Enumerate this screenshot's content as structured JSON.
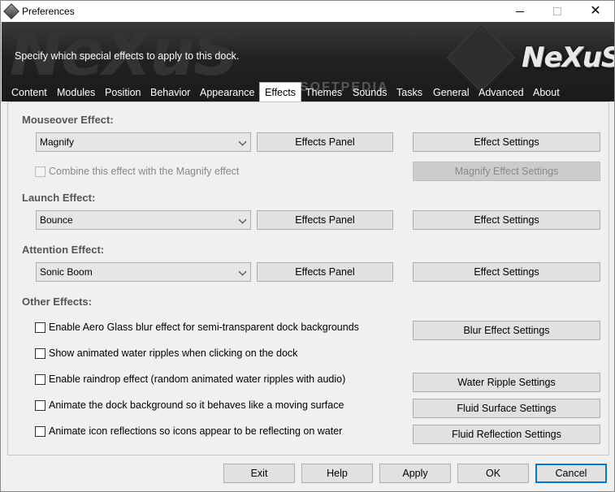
{
  "window": {
    "title": "Preferences"
  },
  "banner": {
    "description": "Specify which special effects to apply to this dock.",
    "logo": "NeXuS",
    "watermark": "SOFTPEDIA"
  },
  "tabs": [
    {
      "label": "Content",
      "active": false
    },
    {
      "label": "Modules",
      "active": false
    },
    {
      "label": "Position",
      "active": false
    },
    {
      "label": "Behavior",
      "active": false
    },
    {
      "label": "Appearance",
      "active": false
    },
    {
      "label": "Effects",
      "active": true
    },
    {
      "label": "Themes",
      "active": false
    },
    {
      "label": "Sounds",
      "active": false
    },
    {
      "label": "Tasks",
      "active": false
    },
    {
      "label": "General",
      "active": false
    },
    {
      "label": "Advanced",
      "active": false
    },
    {
      "label": "About",
      "active": false
    }
  ],
  "mouseover": {
    "label": "Mouseover Effect:",
    "selected": "Magnify",
    "panel_btn": "Effects Panel",
    "settings_btn": "Effect Settings",
    "combine_label": "Combine this effect with the Magnify effect",
    "magnify_settings_btn": "Magnify Effect Settings"
  },
  "launch": {
    "label": "Launch Effect:",
    "selected": "Bounce",
    "panel_btn": "Effects Panel",
    "settings_btn": "Effect Settings"
  },
  "attention": {
    "label": "Attention Effect:",
    "selected": "Sonic Boom",
    "panel_btn": "Effects Panel",
    "settings_btn": "Effect Settings"
  },
  "other": {
    "label": "Other Effects:",
    "aero_label": "Enable Aero Glass blur effect for semi-transparent dock backgrounds",
    "blur_btn": "Blur Effect Settings",
    "ripples_label": "Show animated water ripples when clicking on the dock",
    "raindrop_label": "Enable raindrop effect (random animated water ripples with audio)",
    "water_btn": "Water Ripple Settings",
    "surface_label": "Animate the dock background so it behaves like a moving surface",
    "surface_btn": "Fluid Surface Settings",
    "reflect_label": "Animate icon reflections so icons appear to be reflecting on water",
    "reflect_btn": "Fluid Reflection Settings"
  },
  "footer": {
    "exit": "Exit",
    "help": "Help",
    "apply": "Apply",
    "ok": "OK",
    "cancel": "Cancel"
  }
}
